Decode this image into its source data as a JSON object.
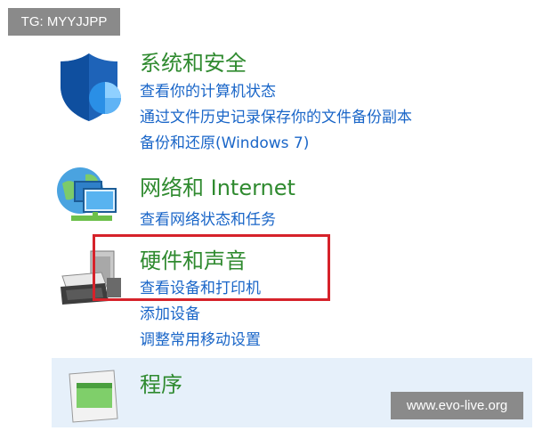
{
  "tg_badge": "TG: MYYJJPP",
  "watermark": "www.evo-live.org",
  "categories": [
    {
      "title": "系统和安全",
      "links": [
        "查看你的计算机状态",
        "通过文件历史记录保存你的文件备份副本",
        "备份和还原(Windows 7)"
      ]
    },
    {
      "title": "网络和 Internet",
      "links": [
        "查看网络状态和任务"
      ]
    },
    {
      "title": "硬件和声音",
      "links": [
        "查看设备和打印机",
        "添加设备",
        "调整常用移动设置"
      ]
    },
    {
      "title": "程序",
      "links": []
    }
  ],
  "colors": {
    "title": "#2f8a2f",
    "link": "#1a66c8",
    "highlight": "#d6222a"
  }
}
